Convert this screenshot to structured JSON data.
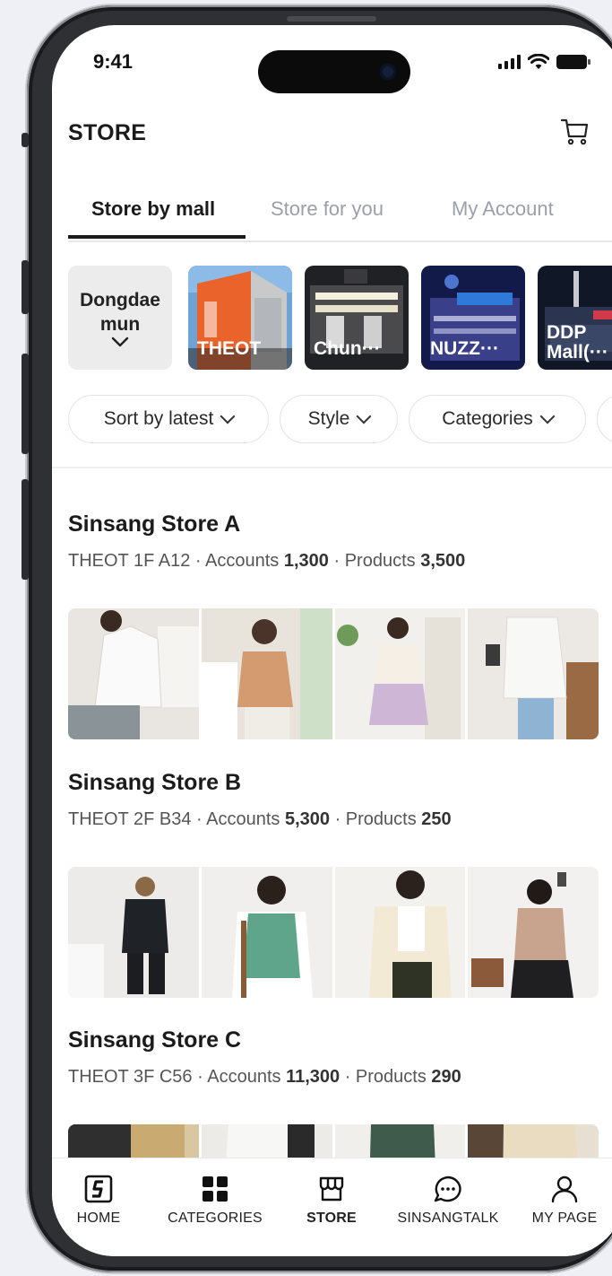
{
  "status_bar": {
    "time": "9:41"
  },
  "header": {
    "title": "STORE",
    "cart_icon": "cart-icon"
  },
  "tabs": [
    {
      "label": "Store by mall",
      "active": true
    },
    {
      "label": "Store for you",
      "active": false
    },
    {
      "label": "My Account",
      "active": false
    }
  ],
  "region_selector": {
    "label_line1": "Dongdae",
    "label_line2": "mun",
    "icon": "chevron-down-icon"
  },
  "malls": [
    {
      "name": "THEOT",
      "selected": true,
      "color": "#e8652d"
    },
    {
      "name": "Chun···",
      "selected": false,
      "color": "#3a3a3a"
    },
    {
      "name": "NUZZ···",
      "selected": false,
      "color": "#2a2f7a"
    },
    {
      "name_line1": "DDP",
      "name_line2": "Mall(···",
      "selected": false,
      "color": "#1c2536"
    }
  ],
  "filters": [
    {
      "label": "Sort by latest"
    },
    {
      "label": "Style"
    },
    {
      "label": "Categories"
    }
  ],
  "stores": [
    {
      "name": "Sinsang Store A",
      "location": "THEOT 1F A12",
      "accounts_label": "Accounts",
      "accounts": "1,300",
      "products_label": "Products",
      "products": "3,500"
    },
    {
      "name": "Sinsang Store B",
      "location": "THEOT 2F B34",
      "accounts_label": "Accounts",
      "accounts": "5,300",
      "products_label": "Products",
      "products": "250"
    },
    {
      "name": "Sinsang Store C",
      "location": "THEOT 3F C56",
      "accounts_label": "Accounts",
      "accounts": "11,300",
      "products_label": "Products",
      "products": "290"
    }
  ],
  "bottom_nav": [
    {
      "label": "HOME",
      "icon": "home-logo-icon"
    },
    {
      "label": "CATEGORIES",
      "icon": "grid-icon"
    },
    {
      "label": "STORE",
      "icon": "storefront-icon",
      "active": true
    },
    {
      "label": "SINSANGTALK",
      "icon": "chat-bubble-icon"
    },
    {
      "label": "MY PAGE",
      "icon": "person-icon"
    }
  ],
  "colors": {
    "accent_selected": "#ef4a64",
    "text_primary": "#1b1b1b",
    "text_muted": "#9aa0aa"
  }
}
